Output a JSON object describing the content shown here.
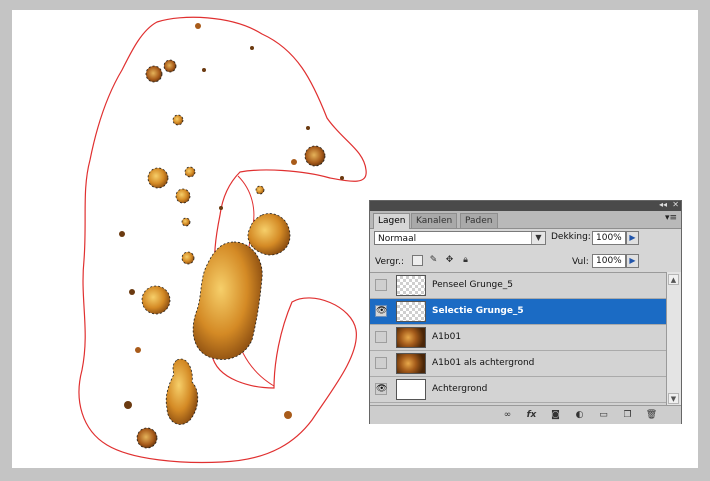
{
  "panel": {
    "tabs": [
      {
        "label": "Lagen",
        "active": true
      },
      {
        "label": "Kanalen",
        "active": false
      },
      {
        "label": "Paden",
        "active": false
      }
    ],
    "collapse_label": "◂◂",
    "close_label": "✕",
    "menu_label": "▾≡",
    "blend_mode": "Normaal",
    "opacity_label": "Dekking:",
    "opacity_value": "100%",
    "lock_label": "Vergr.:",
    "fill_label": "Vul:",
    "fill_value": "100%",
    "layers": [
      {
        "name": "Penseel Grunge_5",
        "visible": false,
        "selected": false,
        "thumb": "transparent"
      },
      {
        "name": "Selectie Grunge_5",
        "visible": true,
        "selected": true,
        "thumb": "transparent"
      },
      {
        "name": "A1b01",
        "visible": false,
        "selected": false,
        "thumb": "photo"
      },
      {
        "name": "A1b01 als achtergrond",
        "visible": false,
        "selected": false,
        "thumb": "photo"
      },
      {
        "name": "Achtergrond",
        "visible": true,
        "selected": false,
        "thumb": "white"
      }
    ],
    "footer_icons": [
      "link-icon",
      "fx-icon",
      "mask-icon",
      "adjustment-icon",
      "folder-icon",
      "new-layer-icon",
      "trash-icon"
    ]
  },
  "colors": {
    "selection_outline": "#e03030",
    "selected_row": "#1b6bc4",
    "grunge_mid": "#d4902c",
    "grunge_dark": "#6b3a10",
    "grunge_light": "#f0c05a"
  }
}
